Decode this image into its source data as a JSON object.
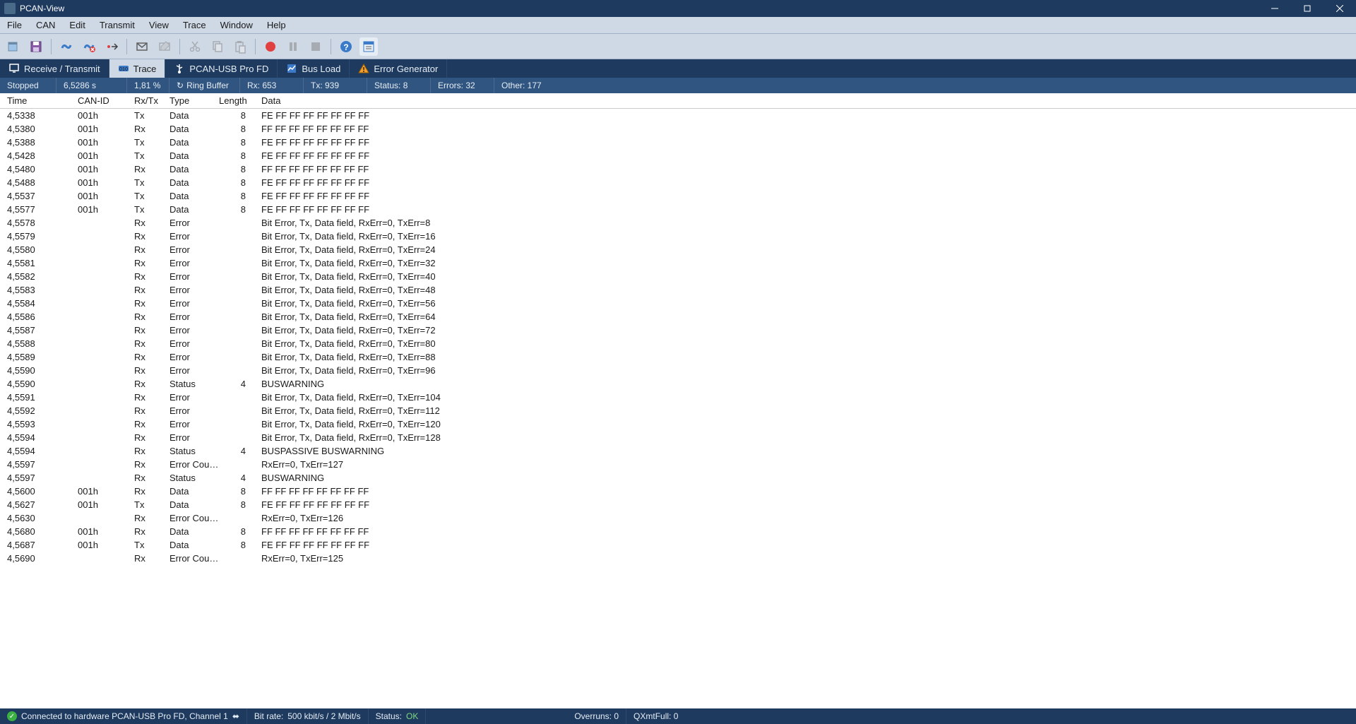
{
  "window": {
    "title": "PCAN-View"
  },
  "menu": {
    "items": [
      "File",
      "CAN",
      "Edit",
      "Transmit",
      "View",
      "Trace",
      "Window",
      "Help"
    ]
  },
  "tabs": [
    {
      "label": "Receive / Transmit",
      "icon": "monitor"
    },
    {
      "label": "Trace",
      "icon": "trace",
      "active": true
    },
    {
      "label": "PCAN-USB Pro FD",
      "icon": "usb"
    },
    {
      "label": "Bus Load",
      "icon": "chart"
    },
    {
      "label": "Error Generator",
      "icon": "warning"
    }
  ],
  "infostrip": {
    "state": "Stopped",
    "time": "6,5286 s",
    "fill": "1,81 %",
    "ring_label": "Ring Buffer",
    "rx": "Rx: 653",
    "tx": "Tx: 939",
    "status": "Status: 8",
    "errors": "Errors: 32",
    "other": "Other: 177"
  },
  "columns": {
    "time": "Time",
    "canid": "CAN-ID",
    "rxtx": "Rx/Tx",
    "type": "Type",
    "length": "Length",
    "data": "Data"
  },
  "rows": [
    {
      "time": "4,5338",
      "canid": "001h",
      "rxtx": "Tx",
      "type": "Data",
      "len": "8",
      "data": "FE FF FF FF FF FF FF FF"
    },
    {
      "time": "4,5380",
      "canid": "001h",
      "rxtx": "Rx",
      "type": "Data",
      "len": "8",
      "data": "FF FF FF FF FF FF FF FF"
    },
    {
      "time": "4,5388",
      "canid": "001h",
      "rxtx": "Tx",
      "type": "Data",
      "len": "8",
      "data": "FE FF FF FF FF FF FF FF"
    },
    {
      "time": "4,5428",
      "canid": "001h",
      "rxtx": "Tx",
      "type": "Data",
      "len": "8",
      "data": "FE FF FF FF FF FF FF FF"
    },
    {
      "time": "4,5480",
      "canid": "001h",
      "rxtx": "Rx",
      "type": "Data",
      "len": "8",
      "data": "FF FF FF FF FF FF FF FF"
    },
    {
      "time": "4,5488",
      "canid": "001h",
      "rxtx": "Tx",
      "type": "Data",
      "len": "8",
      "data": "FE FF FF FF FF FF FF FF"
    },
    {
      "time": "4,5537",
      "canid": "001h",
      "rxtx": "Tx",
      "type": "Data",
      "len": "8",
      "data": "FE FF FF FF FF FF FF FF"
    },
    {
      "time": "4,5577",
      "canid": "001h",
      "rxtx": "Tx",
      "type": "Data",
      "len": "8",
      "data": "FE FF FF FF FF FF FF FF"
    },
    {
      "time": "4,5578",
      "canid": "",
      "rxtx": "Rx",
      "type": "Error",
      "len": "",
      "data": "Bit Error, Tx, Data field, RxErr=0, TxErr=8"
    },
    {
      "time": "4,5579",
      "canid": "",
      "rxtx": "Rx",
      "type": "Error",
      "len": "",
      "data": "Bit Error, Tx, Data field, RxErr=0, TxErr=16"
    },
    {
      "time": "4,5580",
      "canid": "",
      "rxtx": "Rx",
      "type": "Error",
      "len": "",
      "data": "Bit Error, Tx, Data field, RxErr=0, TxErr=24"
    },
    {
      "time": "4,5581",
      "canid": "",
      "rxtx": "Rx",
      "type": "Error",
      "len": "",
      "data": "Bit Error, Tx, Data field, RxErr=0, TxErr=32"
    },
    {
      "time": "4,5582",
      "canid": "",
      "rxtx": "Rx",
      "type": "Error",
      "len": "",
      "data": "Bit Error, Tx, Data field, RxErr=0, TxErr=40"
    },
    {
      "time": "4,5583",
      "canid": "",
      "rxtx": "Rx",
      "type": "Error",
      "len": "",
      "data": "Bit Error, Tx, Data field, RxErr=0, TxErr=48"
    },
    {
      "time": "4,5584",
      "canid": "",
      "rxtx": "Rx",
      "type": "Error",
      "len": "",
      "data": "Bit Error, Tx, Data field, RxErr=0, TxErr=56"
    },
    {
      "time": "4,5586",
      "canid": "",
      "rxtx": "Rx",
      "type": "Error",
      "len": "",
      "data": "Bit Error, Tx, Data field, RxErr=0, TxErr=64"
    },
    {
      "time": "4,5587",
      "canid": "",
      "rxtx": "Rx",
      "type": "Error",
      "len": "",
      "data": "Bit Error, Tx, Data field, RxErr=0, TxErr=72"
    },
    {
      "time": "4,5588",
      "canid": "",
      "rxtx": "Rx",
      "type": "Error",
      "len": "",
      "data": "Bit Error, Tx, Data field, RxErr=0, TxErr=80"
    },
    {
      "time": "4,5589",
      "canid": "",
      "rxtx": "Rx",
      "type": "Error",
      "len": "",
      "data": "Bit Error, Tx, Data field, RxErr=0, TxErr=88"
    },
    {
      "time": "4,5590",
      "canid": "",
      "rxtx": "Rx",
      "type": "Error",
      "len": "",
      "data": "Bit Error, Tx, Data field, RxErr=0, TxErr=96"
    },
    {
      "time": "4,5590",
      "canid": "",
      "rxtx": "Rx",
      "type": "Status",
      "len": "4",
      "data": "BUSWARNING"
    },
    {
      "time": "4,5591",
      "canid": "",
      "rxtx": "Rx",
      "type": "Error",
      "len": "",
      "data": "Bit Error, Tx, Data field, RxErr=0, TxErr=104"
    },
    {
      "time": "4,5592",
      "canid": "",
      "rxtx": "Rx",
      "type": "Error",
      "len": "",
      "data": "Bit Error, Tx, Data field, RxErr=0, TxErr=112"
    },
    {
      "time": "4,5593",
      "canid": "",
      "rxtx": "Rx",
      "type": "Error",
      "len": "",
      "data": "Bit Error, Tx, Data field, RxErr=0, TxErr=120"
    },
    {
      "time": "4,5594",
      "canid": "",
      "rxtx": "Rx",
      "type": "Error",
      "len": "",
      "data": "Bit Error, Tx, Data field, RxErr=0, TxErr=128"
    },
    {
      "time": "4,5594",
      "canid": "",
      "rxtx": "Rx",
      "type": "Status",
      "len": "4",
      "data": "BUSPASSIVE BUSWARNING"
    },
    {
      "time": "4,5597",
      "canid": "",
      "rxtx": "Rx",
      "type": "Error Coun…",
      "len": "",
      "data": "RxErr=0, TxErr=127"
    },
    {
      "time": "4,5597",
      "canid": "",
      "rxtx": "Rx",
      "type": "Status",
      "len": "4",
      "data": "BUSWARNING"
    },
    {
      "time": "4,5600",
      "canid": "001h",
      "rxtx": "Rx",
      "type": "Data",
      "len": "8",
      "data": "FF FF FF FF FF FF FF FF"
    },
    {
      "time": "4,5627",
      "canid": "001h",
      "rxtx": "Tx",
      "type": "Data",
      "len": "8",
      "data": "FE FF FF FF FF FF FF FF"
    },
    {
      "time": "4,5630",
      "canid": "",
      "rxtx": "Rx",
      "type": "Error Coun…",
      "len": "",
      "data": "RxErr=0, TxErr=126"
    },
    {
      "time": "4,5680",
      "canid": "001h",
      "rxtx": "Rx",
      "type": "Data",
      "len": "8",
      "data": "FF FF FF FF FF FF FF FF"
    },
    {
      "time": "4,5687",
      "canid": "001h",
      "rxtx": "Tx",
      "type": "Data",
      "len": "8",
      "data": "FE FF FF FF FF FF FF FF"
    },
    {
      "time": "4,5690",
      "canid": "",
      "rxtx": "Rx",
      "type": "Error Coun…",
      "len": "",
      "data": "RxErr=0, TxErr=125"
    }
  ],
  "statusbar": {
    "connection": "Connected to hardware PCAN-USB Pro FD, Channel 1",
    "bitrate_label": "Bit rate:",
    "bitrate_value": "500 kbit/s / 2 Mbit/s",
    "status_label": "Status:",
    "status_value": "OK",
    "overruns": "Overruns: 0",
    "qxmt": "QXmtFull: 0"
  }
}
